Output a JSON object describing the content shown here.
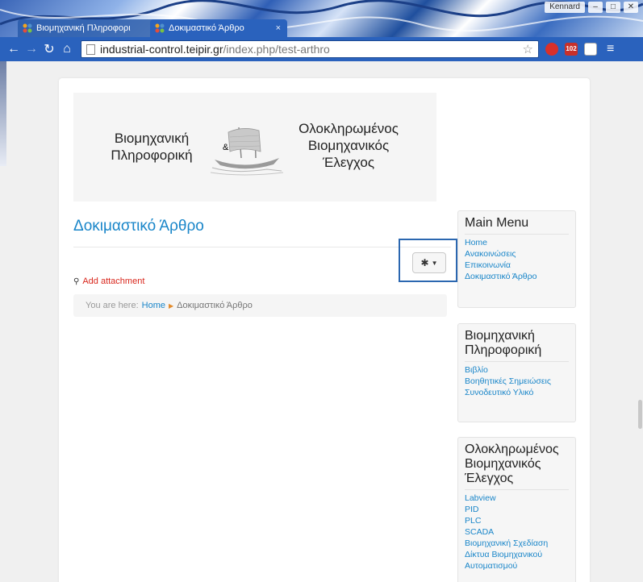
{
  "browser": {
    "tabs": [
      {
        "title": "Βιομηχανική Πληροφορι",
        "active": false
      },
      {
        "title": "Δοκιμαστικό Άρθρο",
        "active": true
      }
    ],
    "tab_close": "×",
    "user": "Kennard",
    "address": {
      "host": "industrial-control.teipir.gr",
      "path": "/index.php/test-arthro"
    },
    "gmail_count": "102",
    "accent_color": "#2a62bd"
  },
  "banner": {
    "left_text": [
      "Βιομηχανική",
      "Πληροφορική"
    ],
    "amp": "&",
    "right_text": [
      "Ολοκληρωμένος",
      "Βιομηχανικός",
      "Έλεγχος"
    ]
  },
  "article": {
    "title": "Δοκιμαστικό Άρθρο",
    "attachment_label": "Add attachment"
  },
  "breadcrumb": {
    "prefix": "You are here:",
    "home": "Home",
    "current": "Δοκιμαστικό Άρθρο"
  },
  "modules": [
    {
      "title": "Main Menu",
      "items": [
        "Home",
        "Ανακοινώσεις",
        "Επικοινωνία",
        "Δοκιμαστικό Άρθρο"
      ]
    },
    {
      "title": "Βιομηχανική Πληροφορική",
      "items": [
        "Βιβλίο",
        "Βοηθητικές Σημειώσεις",
        "Συνοδευτικό Υλικό"
      ]
    },
    {
      "title": "Ολοκληρωμένος Βιομηχανικός Έλεγχος",
      "items": [
        "Labview",
        "PID",
        "PLC",
        "SCADA",
        "Βιομηχανική Σχεδίαση",
        "Δίκτυα Βιομηχανικού Αυτοματισμού"
      ]
    }
  ]
}
